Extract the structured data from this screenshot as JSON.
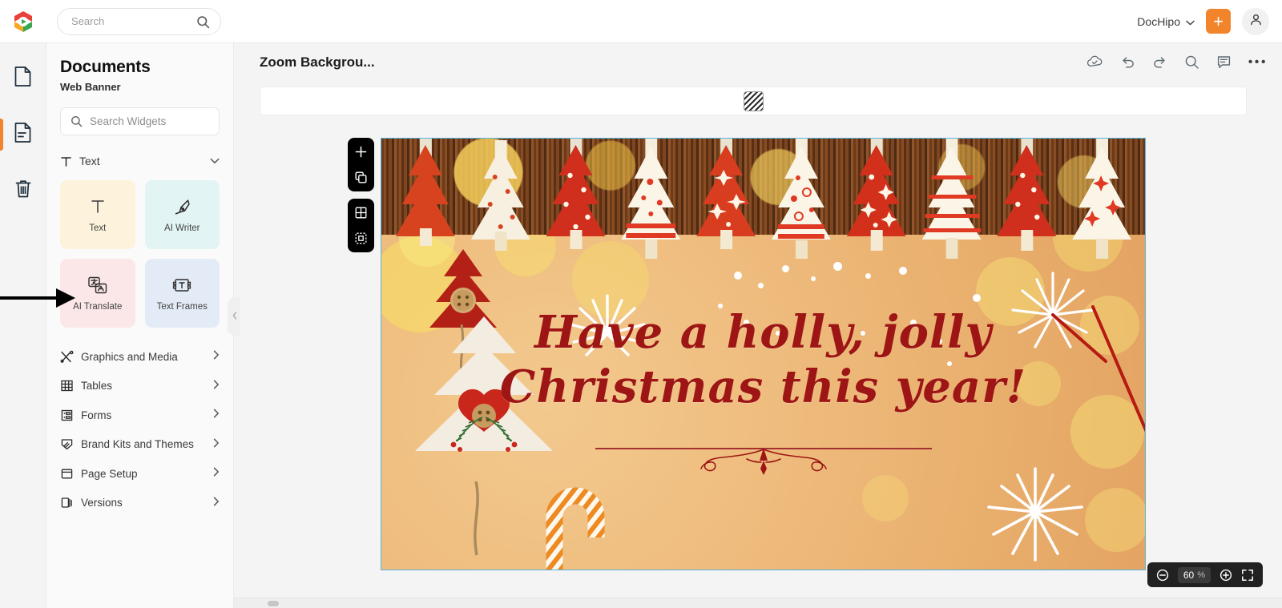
{
  "topbar": {
    "logo_icon": "dochipo-logo-icon",
    "search": {
      "placeholder": "Search",
      "value": "",
      "icon": "search-icon"
    },
    "workspace": {
      "name": "DocHipo",
      "chevron_icon": "chevron-down-icon"
    },
    "create_button": {
      "label": "+",
      "icon": "plus-icon",
      "color": "#f2842c"
    },
    "account": {
      "icon": "user-avatar-icon"
    }
  },
  "rail": {
    "items": [
      {
        "name": "pages",
        "icon": "page-blank-icon",
        "active": false
      },
      {
        "name": "document",
        "icon": "document-lines-icon",
        "active": true
      },
      {
        "name": "trash",
        "icon": "trash-icon",
        "active": false
      }
    ],
    "active_indicator_color": "#f2842c"
  },
  "panel": {
    "title": "Documents",
    "subtitle": "Web Banner",
    "search": {
      "placeholder": "Search Widgets",
      "value": "",
      "icon": "search-icon"
    },
    "section": {
      "label": "Text",
      "icon": "text-t-icon",
      "chevron_icon": "chevron-down-icon",
      "expanded": true
    },
    "cards": [
      {
        "label": "Text",
        "icon": "text-t-icon",
        "bg": "#fdf3dc"
      },
      {
        "label": "AI Writer",
        "icon": "pen-nib-icon",
        "bg": "#e2f4f3"
      },
      {
        "label": "AI Translate",
        "icon": "translate-icon",
        "bg": "#fbe7e7",
        "highlighted": true
      },
      {
        "label": "Text Frames",
        "icon": "text-frame-icon",
        "bg": "#e3ebf7"
      }
    ],
    "menu": [
      {
        "label": "Graphics and Media",
        "icon": "graphics-media-icon",
        "chevron_icon": "chevron-right-icon"
      },
      {
        "label": "Tables",
        "icon": "table-grid-icon",
        "chevron_icon": "chevron-right-icon"
      },
      {
        "label": "Forms",
        "icon": "form-icon",
        "chevron_icon": "chevron-right-icon"
      },
      {
        "label": "Brand Kits and Themes",
        "icon": "brand-kit-icon",
        "chevron_icon": "chevron-right-icon"
      },
      {
        "label": "Page Setup",
        "icon": "page-setup-icon",
        "chevron_icon": "chevron-right-icon"
      },
      {
        "label": "Versions",
        "icon": "versions-icon",
        "chevron_icon": "chevron-right-icon"
      }
    ],
    "collapse_handle_icon": "chevron-left-icon"
  },
  "editor": {
    "document_title": "Zoom Backgrou...",
    "actions": [
      {
        "name": "cloud-saved",
        "icon": "cloud-check-icon"
      },
      {
        "name": "undo",
        "icon": "undo-arrow-icon"
      },
      {
        "name": "redo",
        "icon": "redo-arrow-icon"
      },
      {
        "name": "find",
        "icon": "search-icon"
      },
      {
        "name": "comments",
        "icon": "comment-icon"
      },
      {
        "name": "more-options",
        "icon": "ellipsis-icon",
        "label": "•••"
      }
    ],
    "format_strip": {
      "fill_swatch_icon": "hatch-pattern-icon"
    },
    "page_tools": [
      {
        "name": "add-page",
        "icon": "plus-icon"
      },
      {
        "name": "duplicate-page",
        "icon": "duplicate-icon"
      },
      {
        "name": "grid-view",
        "icon": "grid-icon"
      },
      {
        "name": "snap-guides",
        "icon": "snap-guides-icon"
      }
    ],
    "zoom": {
      "out_icon": "zoom-out-icon",
      "in_icon": "zoom-in-icon",
      "fit_icon": "fullscreen-icon",
      "value": "60",
      "unit": "%"
    }
  },
  "canvas": {
    "selected": true,
    "selection_color": "#59b4e0",
    "design_name": "Christmas web banner",
    "headline_line1": "Have a holly, jolly",
    "headline_line2": "Christmas this year!",
    "headline_color": "#9e1515",
    "background_color": "#eebb7c",
    "ornament_divider_icon": "flourish-ornament-icon",
    "decorations": [
      "christmas-tree-clips",
      "sparkler-bursts",
      "candy-cane",
      "bokeh-lights",
      "wood-backdrop"
    ]
  },
  "annotation": {
    "arrow_icon": "pointer-arrow-icon",
    "target": "AI Translate"
  }
}
